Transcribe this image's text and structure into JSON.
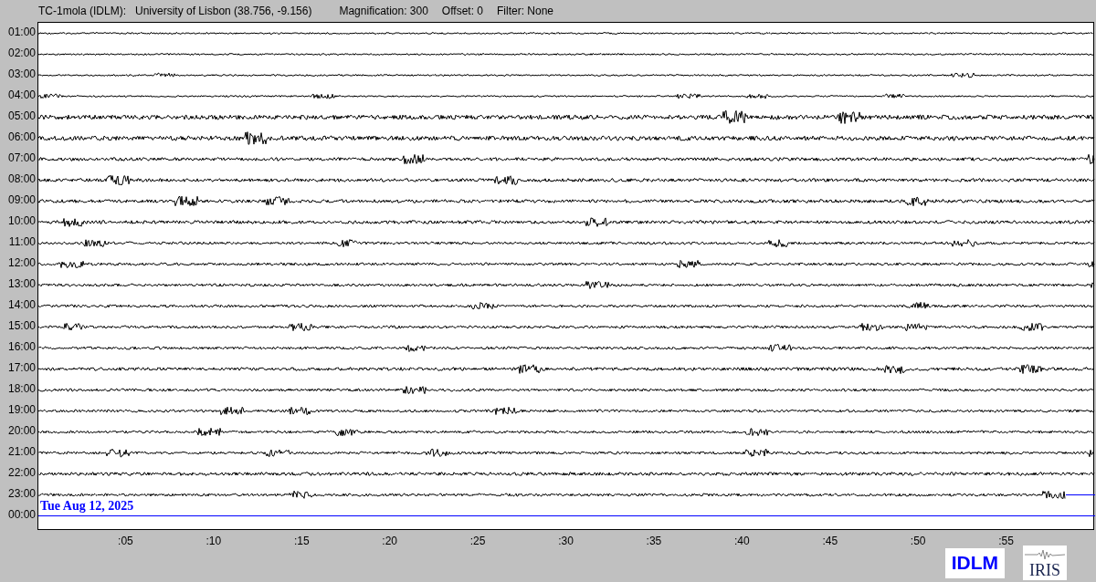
{
  "header": {
    "station": "TC-1mola (IDLM):",
    "location": "University of Lisbon (38.756, -9.156)",
    "magnification": "Magnification: 300",
    "offset": "Offset: 0",
    "filter": "Filter: None"
  },
  "rows": [
    {
      "label": "01:00",
      "kind": "trace"
    },
    {
      "label": "02:00",
      "kind": "trace"
    },
    {
      "label": "03:00",
      "kind": "trace"
    },
    {
      "label": "04:00",
      "kind": "trace"
    },
    {
      "label": "05:00",
      "kind": "trace"
    },
    {
      "label": "06:00",
      "kind": "trace"
    },
    {
      "label": "07:00",
      "kind": "trace"
    },
    {
      "label": "08:00",
      "kind": "trace"
    },
    {
      "label": "09:00",
      "kind": "trace"
    },
    {
      "label": "10:00",
      "kind": "trace"
    },
    {
      "label": "11:00",
      "kind": "trace"
    },
    {
      "label": "12:00",
      "kind": "trace"
    },
    {
      "label": "13:00",
      "kind": "trace"
    },
    {
      "label": "14:00",
      "kind": "trace"
    },
    {
      "label": "15:00",
      "kind": "trace"
    },
    {
      "label": "16:00",
      "kind": "trace"
    },
    {
      "label": "17:00",
      "kind": "trace"
    },
    {
      "label": "18:00",
      "kind": "trace"
    },
    {
      "label": "19:00",
      "kind": "trace"
    },
    {
      "label": "20:00",
      "kind": "trace"
    },
    {
      "label": "21:00",
      "kind": "trace"
    },
    {
      "label": "22:00",
      "kind": "trace"
    },
    {
      "label": "23:00",
      "kind": "partial"
    },
    {
      "label": "00:00",
      "kind": "current"
    }
  ],
  "date_label": "Tue Aug 12, 2025",
  "x_ticks": [
    ":05",
    ":10",
    ":15",
    ":20",
    ":25",
    ":30",
    ":35",
    ":40",
    ":45",
    ":50",
    ":55"
  ],
  "logos": {
    "station": "IDLM",
    "network": "IRIS"
  }
}
